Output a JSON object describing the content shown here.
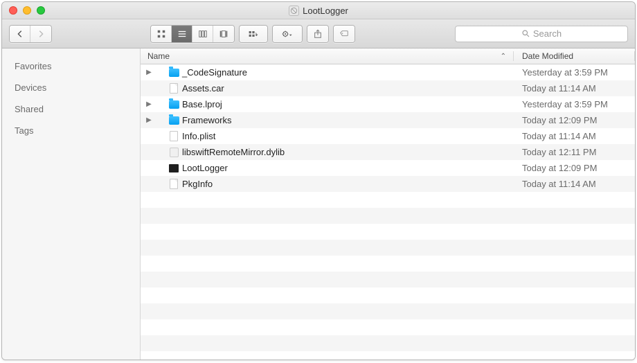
{
  "window": {
    "title": "LootLogger"
  },
  "toolbar": {
    "search_placeholder": "Search"
  },
  "sidebar": {
    "items": [
      {
        "label": "Favorites"
      },
      {
        "label": "Devices"
      },
      {
        "label": "Shared"
      },
      {
        "label": "Tags"
      }
    ]
  },
  "columns": {
    "name": "Name",
    "date": "Date Modified"
  },
  "files": [
    {
      "name": "_CodeSignature",
      "date": "Yesterday at 3:59 PM",
      "kind": "folder",
      "expandable": true
    },
    {
      "name": "Assets.car",
      "date": "Today at 11:14 AM",
      "kind": "file",
      "expandable": false
    },
    {
      "name": "Base.lproj",
      "date": "Yesterday at 3:59 PM",
      "kind": "folder",
      "expandable": true
    },
    {
      "name": "Frameworks",
      "date": "Today at 12:09 PM",
      "kind": "folder",
      "expandable": true
    },
    {
      "name": "Info.plist",
      "date": "Today at 11:14 AM",
      "kind": "plist",
      "expandable": false
    },
    {
      "name": "libswiftRemoteMirror.dylib",
      "date": "Today at 12:11 PM",
      "kind": "dylib",
      "expandable": false
    },
    {
      "name": "LootLogger",
      "date": "Today at 12:09 PM",
      "kind": "exec",
      "expandable": false
    },
    {
      "name": "PkgInfo",
      "date": "Today at 11:14 AM",
      "kind": "file",
      "expandable": false
    }
  ]
}
